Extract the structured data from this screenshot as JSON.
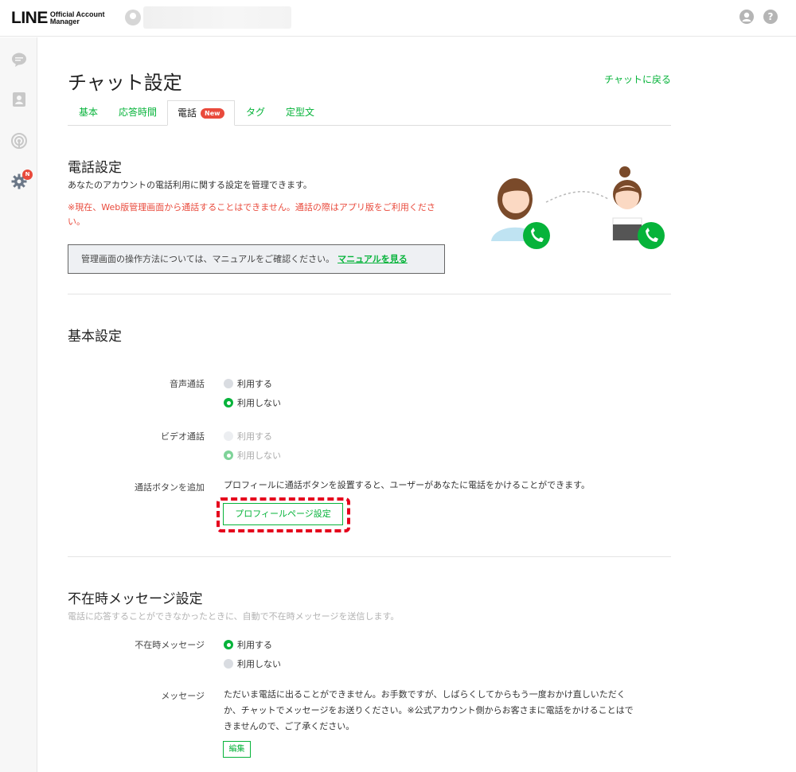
{
  "app": {
    "logo_main": "LINE",
    "logo_sub_1": "Official Account",
    "logo_sub_2": "Manager",
    "help_glyph": "?"
  },
  "sidebar": {
    "items": [
      {
        "icon": "chat-bubble-icon"
      },
      {
        "icon": "contacts-icon"
      },
      {
        "icon": "broadcast-icon"
      },
      {
        "icon": "gear-icon",
        "badge": "N",
        "active": true
      }
    ]
  },
  "page": {
    "title": "チャット設定",
    "back_link": "チャットに戻る"
  },
  "tabs": [
    {
      "label": "基本"
    },
    {
      "label": "応答時間"
    },
    {
      "label": "電話",
      "badge": "New",
      "active": true
    },
    {
      "label": "タグ"
    },
    {
      "label": "定型文"
    }
  ],
  "phone_settings": {
    "title": "電話設定",
    "description": "あなたのアカウントの電話利用に関する設定を管理できます。",
    "notice_line1": "※現在、Web版管理画面から通話することはできません。通話の際はアプリ版をご利用くださ",
    "notice_line2": "い。",
    "manual_text": "管理画面の操作方法については、マニュアルをご確認ください。",
    "manual_link": "マニュアルを見る"
  },
  "basic_settings": {
    "title": "基本設定",
    "voice_call": {
      "label": "音声通話",
      "options": [
        "利用する",
        "利用しない"
      ],
      "selected": "利用しない"
    },
    "video_call": {
      "label": "ビデオ通話",
      "options": [
        "利用する",
        "利用しない"
      ],
      "selected": "利用しない",
      "disabled": true
    },
    "call_button": {
      "label": "通話ボタンを追加",
      "text": "プロフィールに通話ボタンを設置すると、ユーザーがあなたに電話をかけることができます。",
      "button": "プロフィールページ設定"
    }
  },
  "absence": {
    "title": "不在時メッセージ設定",
    "description": "電話に応答することができなかったときに、自動で不在時メッセージを送信します。",
    "absence_message": {
      "label": "不在時メッセージ",
      "options": [
        "利用する",
        "利用しない"
      ],
      "selected": "利用する"
    },
    "message": {
      "label": "メッセージ",
      "line1": "ただいま電話に出ることができません。お手数ですが、しばらくしてからもう一度おかけ直しいただく",
      "line2": "か、チャットでメッセージをお送りください。※公式アカウント側からお客さまに電話をかけることはで",
      "line3": "きませんので、ご了承ください。",
      "edit_button": "編集"
    }
  },
  "colors": {
    "accent_green": "#06b33a",
    "alert_red": "#e94a3c",
    "highlight_red": "#e5001c"
  }
}
